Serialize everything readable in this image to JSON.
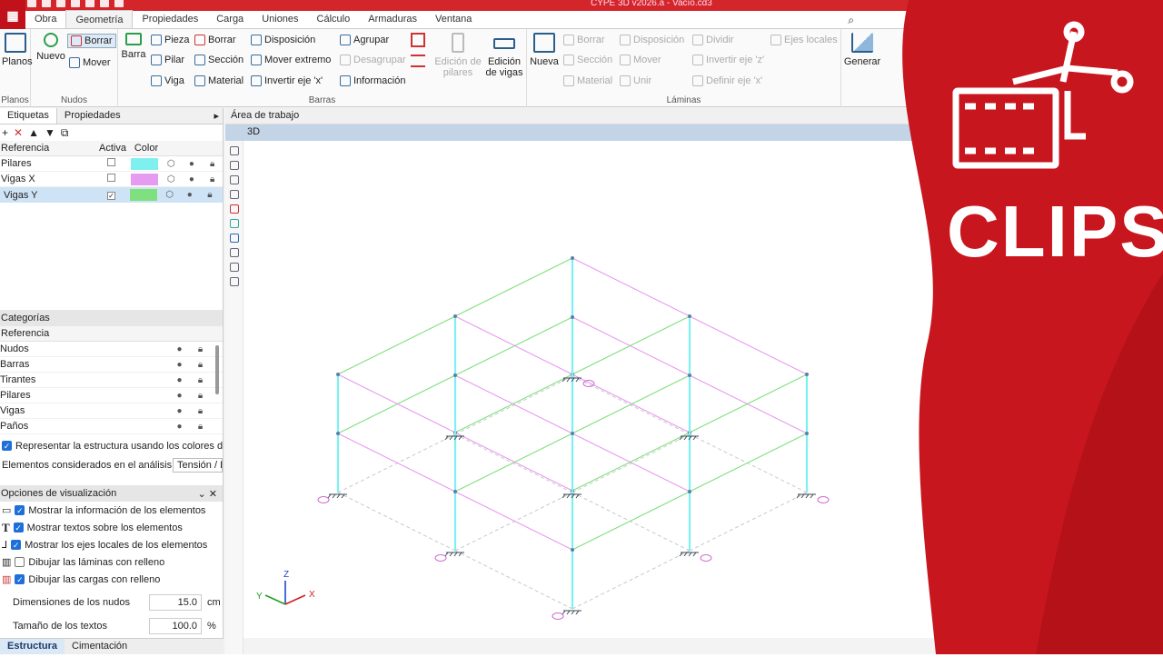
{
  "app": {
    "title": "CYPE 3D v2026.a - Vacío.cd3"
  },
  "menu": [
    "Obra",
    "Geometría",
    "Propiedades",
    "Carga",
    "Uniones",
    "Cálculo",
    "Armaduras",
    "Ventana"
  ],
  "menu_active": "Geometría",
  "ribbon": {
    "planos": {
      "button": "Planos",
      "group": "Planos"
    },
    "nudos": {
      "nuevo": "Nuevo",
      "borrar": "Borrar",
      "mover": "Mover",
      "group": "Nudos"
    },
    "barras": {
      "barra": "Barra",
      "pieza": "Pieza",
      "pilar": "Pilar",
      "viga": "Viga",
      "borrar": "Borrar",
      "seccion": "Sección",
      "material": "Material",
      "disposicion": "Disposición",
      "mover_extremo": "Mover extremo",
      "invertir_eje": "Invertir eje 'x'",
      "agrupar": "Agrupar",
      "desagrupar": "Desagrupar",
      "informacion": "Información",
      "edicion_pilares": "Edición de pilares",
      "edicion_vigas": "Edición de vigas",
      "group": "Barras"
    },
    "laminas": {
      "nueva": "Nueva",
      "borrar": "Borrar",
      "seccion": "Sección",
      "material": "Material",
      "disposicion": "Disposición",
      "mover": "Mover",
      "unir": "Unir",
      "dividir": "Dividir",
      "invertir_z": "Invertir eje 'z'",
      "definir_x": "Definir eje 'x'",
      "ejes_locales": "Ejes locales",
      "group": "Láminas"
    },
    "generar": "Generar"
  },
  "left_panel": {
    "tabs": [
      "Etiquetas",
      "Propiedades"
    ],
    "labels_header": {
      "ref": "Referencia",
      "active": "Activa",
      "color": "Color"
    },
    "labels": [
      {
        "name": "Pilares",
        "active": false,
        "color": "#7ff0f0"
      },
      {
        "name": "Vigas X",
        "active": false,
        "color": "#e79bf0"
      },
      {
        "name": "Vigas Y",
        "active": true,
        "color": "#7fe07f"
      }
    ],
    "categories_title": "Categorías",
    "categories_header": "Referencia",
    "categories": [
      "Nudos",
      "Barras",
      "Tirantes",
      "Pilares",
      "Vigas",
      "Paños"
    ],
    "represent_label": "Representar la estructura usando los colores de l",
    "elements_label": "Elementos considerados en el análisis",
    "elements_value": "Tensión / D",
    "view_options_title": "Opciones de visualización",
    "view_options": [
      {
        "label": "Mostrar la información de los elementos",
        "checked": true
      },
      {
        "label": "Mostrar textos sobre los elementos",
        "checked": true
      },
      {
        "label": "Mostrar los ejes locales de los elementos",
        "checked": true
      },
      {
        "label": "Dibujar las láminas con relleno",
        "checked": false
      },
      {
        "label": "Dibujar las cargas con relleno",
        "checked": true
      }
    ],
    "node_dim_label": "Dimensiones de los nudos",
    "node_dim_value": "15.0",
    "node_dim_unit": "cm",
    "text_size_label": "Tamaño de los textos",
    "text_size_value": "100.0",
    "text_size_unit": "%",
    "bottom_tabs": [
      "Estructura",
      "Cimentación"
    ]
  },
  "work_area": {
    "title": "Área de trabajo",
    "view_tab": "3D",
    "axis_labels": {
      "x": "X",
      "y": "Y",
      "z": "Z"
    }
  },
  "overlay": {
    "text": "CLIPS",
    "colors": {
      "red": "#c8161e",
      "dark_red": "#a80f16"
    }
  }
}
